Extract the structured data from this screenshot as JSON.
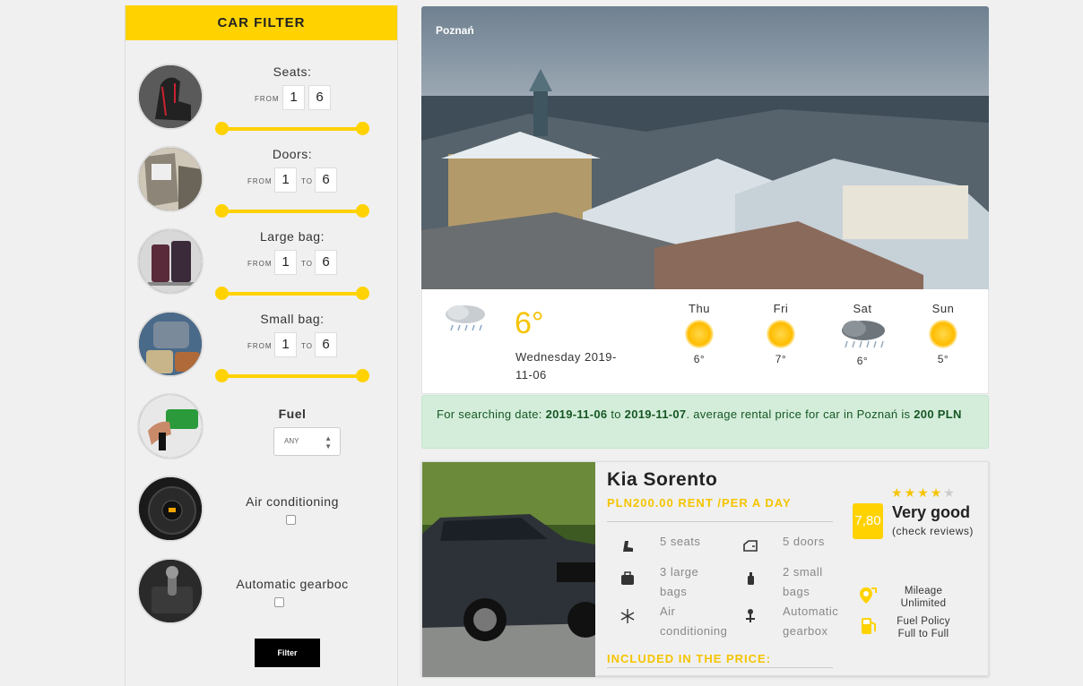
{
  "filter": {
    "title": "CAR FILTER",
    "seats": {
      "label": "Seats:",
      "from_label": "FROM",
      "from": "1",
      "to": "6"
    },
    "doors": {
      "label": "Doors:",
      "from_label": "FROM",
      "to_label": "TO",
      "from": "1",
      "to": "6"
    },
    "large_bag": {
      "label": "Large bag:",
      "from_label": "FROM",
      "to_label": "TO",
      "from": "1",
      "to": "6"
    },
    "small_bag": {
      "label": "Small bag:",
      "from_label": "FROM",
      "to_label": "TO",
      "from": "1",
      "to": "6"
    },
    "fuel": {
      "label": "Fuel",
      "selected": "ANY"
    },
    "air_conditioning": {
      "label": "Air conditioning",
      "checked": false
    },
    "gearbox": {
      "label": "Automatic gearboc",
      "checked": false
    },
    "button": "Filter",
    "accent": "#ffd200"
  },
  "hero": {
    "city": "Poznań"
  },
  "weather": {
    "temp": "6°",
    "date": "Wednesday 2019-11-06",
    "forecast": [
      {
        "day": "Thu",
        "temp": "6°",
        "icon": "sun-icon"
      },
      {
        "day": "Fri",
        "temp": "7°",
        "icon": "sun-icon"
      },
      {
        "day": "Sat",
        "temp": "6°",
        "icon": "cloud-rain-icon"
      },
      {
        "day": "Sun",
        "temp": "5°",
        "icon": "sun-icon"
      }
    ]
  },
  "notice": {
    "prefix": "For searching date: ",
    "date_from": "2019-11-06",
    "to": " to ",
    "date_to": "2019-11-07",
    "middle": ". average rental price for car in Poznań is ",
    "price": "200 PLN"
  },
  "car": {
    "name": "Kia Sorento",
    "price": "PLN200.00 RENT /PER A DAY",
    "features": {
      "seats": "5 seats",
      "doors": "5 doors",
      "large_bags": "3 large bags",
      "small_bags": "2 small bags",
      "air": "Air conditioning",
      "gearbox": "Automatic gearbox"
    },
    "score": "7,80",
    "stars": 4,
    "stars_max": 5,
    "rating_word": "Very good",
    "rating_link": "(check reviews)",
    "mileage_label": "Mileage",
    "mileage_value": "Unlimited",
    "fuel_policy_label": "Fuel Policy",
    "fuel_policy_value": "Full to Full",
    "included": "INCLUDED IN THE PRICE:"
  }
}
